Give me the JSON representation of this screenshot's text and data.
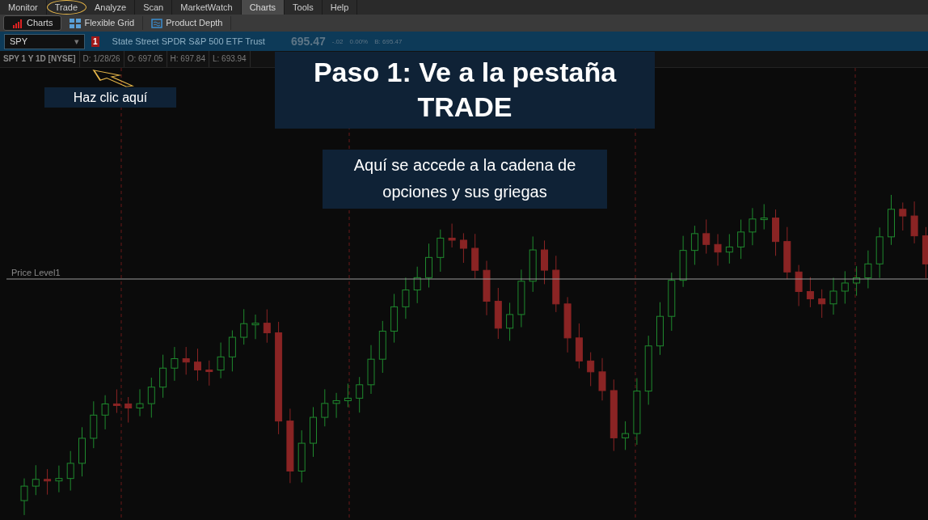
{
  "menu": [
    {
      "label": "Monitor",
      "selected": false,
      "circled": false
    },
    {
      "label": "Trade",
      "selected": false,
      "circled": true
    },
    {
      "label": "Analyze",
      "selected": false,
      "circled": false
    },
    {
      "label": "Scan",
      "selected": false,
      "circled": false
    },
    {
      "label": "MarketWatch",
      "selected": false,
      "circled": false
    },
    {
      "label": "Charts",
      "selected": true,
      "circled": false
    },
    {
      "label": "Tools",
      "selected": false,
      "circled": false
    },
    {
      "label": "Help",
      "selected": false,
      "circled": false
    }
  ],
  "subtabs": [
    {
      "label": "Charts",
      "kind": "charts",
      "selected": true
    },
    {
      "label": "Flexible Grid",
      "kind": "grid",
      "selected": false
    },
    {
      "label": "Product Depth",
      "kind": "depth",
      "selected": false
    }
  ],
  "symbol_field": {
    "value": "SPY",
    "dropdown": "▾"
  },
  "alert_badge": "1",
  "description": "State Street SPDR S&P 500 ETF Trust",
  "quote": {
    "last": "695.47",
    "change": "-.02",
    "change_pct": "0.00%",
    "bid": "B: 695.47"
  },
  "chart_header": [
    "SPY 1 Y 1D [NYSE]",
    "D: 1/28/26",
    "O: 697.05",
    "H: 697.84",
    "L: 693.94"
  ],
  "price_level": "Price Level1",
  "pointer_callout": "Haz clic aquí",
  "step_title": "Paso 1: Ve a la pestaña TRADE",
  "step_note": "Aquí se accede a la cadena de opciones y sus griegas"
}
